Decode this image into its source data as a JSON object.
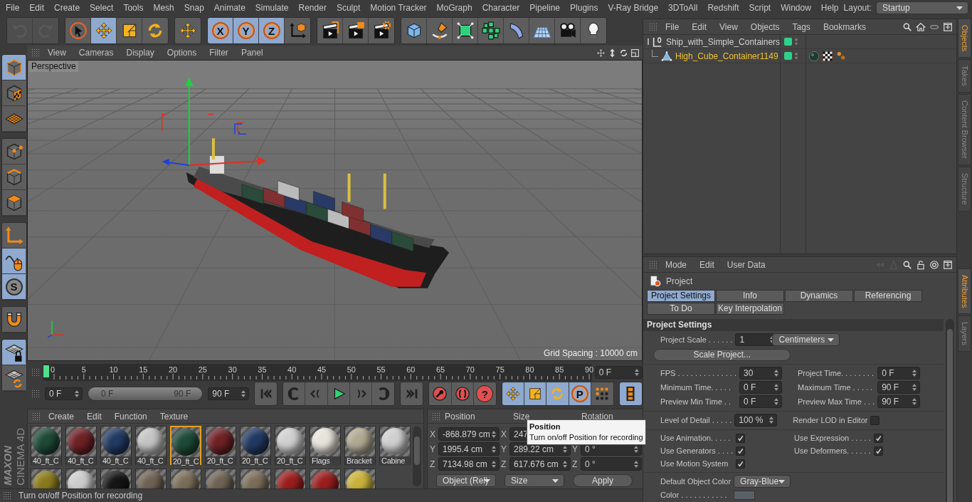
{
  "menu": [
    "File",
    "Edit",
    "Create",
    "Select",
    "Tools",
    "Mesh",
    "Snap",
    "Animate",
    "Simulate",
    "Render",
    "Sculpt",
    "Motion Tracker",
    "MoGraph",
    "Character",
    "Pipeline",
    "Plugins",
    "V-Ray Bridge",
    "3DToAll",
    "Redshift",
    "Script",
    "Window",
    "Help"
  ],
  "layout": {
    "label": "Layout:",
    "value": "Startup"
  },
  "toolbar": [
    {
      "tools": [
        {
          "kind": "undo",
          "active": false,
          "disabled": true
        },
        {
          "kind": "redo",
          "active": false,
          "disabled": true
        }
      ]
    },
    {
      "tools": [
        {
          "kind": "select",
          "active": false,
          "disabled": false
        },
        {
          "kind": "move",
          "active": true,
          "disabled": false
        },
        {
          "kind": "scale",
          "active": false,
          "disabled": false
        },
        {
          "kind": "rotate",
          "active": false,
          "disabled": false
        }
      ]
    },
    {
      "tools": [
        {
          "kind": "move",
          "active": false,
          "disabled": false
        }
      ]
    },
    {
      "tools": [
        {
          "kind": "axis",
          "label": "X",
          "active": true,
          "disabled": false
        },
        {
          "kind": "axis",
          "label": "Y",
          "active": true,
          "disabled": false
        },
        {
          "kind": "axis",
          "label": "Z",
          "active": true,
          "disabled": false
        },
        {
          "kind": "coord",
          "active": false,
          "disabled": false
        }
      ]
    },
    {
      "tools": [
        {
          "kind": "renderview",
          "active": false,
          "disabled": false
        },
        {
          "kind": "render",
          "active": false,
          "disabled": false
        },
        {
          "kind": "rendersettings",
          "active": false,
          "disabled": false
        }
      ]
    },
    {
      "tools": [
        {
          "kind": "cube",
          "active": false,
          "disabled": false
        },
        {
          "kind": "pen",
          "active": false,
          "disabled": false
        },
        {
          "kind": "generator",
          "active": false,
          "disabled": false
        },
        {
          "kind": "cloner",
          "active": false,
          "disabled": false
        },
        {
          "kind": "deformer",
          "active": false,
          "disabled": false
        },
        {
          "kind": "floor",
          "active": false,
          "disabled": false
        },
        {
          "kind": "camera",
          "active": false,
          "disabled": false
        },
        {
          "kind": "light",
          "active": false,
          "disabled": false
        }
      ]
    }
  ],
  "sidetools": [
    {
      "tools": [
        {
          "kind": "model",
          "active": true
        },
        {
          "kind": "texture",
          "active": false
        },
        {
          "kind": "workplane",
          "active": false
        }
      ]
    },
    {
      "tools": [
        {
          "kind": "points",
          "active": false
        },
        {
          "kind": "edges",
          "active": false
        },
        {
          "kind": "polygons",
          "active": false
        }
      ]
    },
    {
      "tools": [
        {
          "kind": "axistool",
          "active": false
        },
        {
          "kind": "tweak",
          "active": true
        },
        {
          "kind": "snap",
          "label": "S",
          "active": true
        }
      ]
    },
    {
      "tools": [
        {
          "kind": "magnet",
          "active": false
        }
      ]
    },
    {
      "tools": [
        {
          "kind": "lockwp",
          "active": true
        },
        {
          "kind": "syncwp",
          "active": false
        }
      ]
    }
  ],
  "logo": {
    "brand": "MAXON",
    "product": "CINEMA 4D"
  },
  "viewport": {
    "menu": [
      "View",
      "Cameras",
      "Display",
      "Options",
      "Filter",
      "Panel"
    ],
    "camera": "Perspective",
    "grid_spacing": "Grid Spacing : 10000 cm"
  },
  "timeline": {
    "ticks": [
      "0",
      "5",
      "10",
      "15",
      "20",
      "25",
      "30",
      "35",
      "40",
      "45",
      "50",
      "55",
      "60",
      "65",
      "70",
      "75",
      "80",
      "85",
      "90"
    ],
    "current_frame": "0 F",
    "start": "0 F",
    "range": {
      "start": "0 F",
      "end": "90 F",
      "level": 1
    },
    "end": "90 F",
    "transport": [
      {
        "tools": [
          {
            "kind": "first",
            "active": false
          }
        ]
      },
      {
        "tools": [
          {
            "kind": "prevkey",
            "active": false
          },
          {
            "kind": "prevframe",
            "active": false
          },
          {
            "kind": "play",
            "active": false
          },
          {
            "kind": "nextframe",
            "active": false
          },
          {
            "kind": "nextkey",
            "active": false
          }
        ]
      },
      {
        "tools": [
          {
            "kind": "last",
            "active": false
          }
        ]
      },
      {
        "tools": [
          {
            "kind": "record",
            "active": false
          },
          {
            "kind": "autokey",
            "active": false
          },
          {
            "kind": "keysel",
            "label": "?",
            "active": false
          }
        ]
      },
      {
        "tools": [
          {
            "kind": "move",
            "active": true
          },
          {
            "kind": "scale",
            "active": true
          },
          {
            "kind": "rotate",
            "active": true
          },
          {
            "kind": "param",
            "label": "P",
            "active": true
          },
          {
            "kind": "dots",
            "active": false
          }
        ]
      },
      {
        "tools": [
          {
            "kind": "film",
            "active": true
          }
        ]
      }
    ]
  },
  "materials": {
    "menu": [
      "Create",
      "Edit",
      "Function",
      "Texture"
    ],
    "items": [
      {
        "name": "40_ft_C",
        "color": "#1f4a38",
        "selected": false
      },
      {
        "name": "40_ft_C",
        "color": "#6e2226",
        "selected": false
      },
      {
        "name": "40_ft_C",
        "color": "#223a63",
        "selected": false
      },
      {
        "name": "40_ft_C",
        "color": "#c4c4c4",
        "selected": false
      },
      {
        "name": "20_ft_C",
        "color": "#1f4a38",
        "selected": true
      },
      {
        "name": "20_ft_C",
        "color": "#6e2226",
        "selected": false
      },
      {
        "name": "20_ft_C",
        "color": "#223a63",
        "selected": false
      },
      {
        "name": "20_ft_C",
        "color": "#d0d0d0",
        "selected": false
      },
      {
        "name": "Flags",
        "color": "#e8e4dc",
        "selected": false
      },
      {
        "name": "Bracket",
        "color": "#b0a892",
        "selected": false
      },
      {
        "name": "Cabine",
        "color": "#cfcfcf",
        "selected": false
      },
      {
        "color": "#8a7a1e",
        "selected": false
      },
      {
        "color": "#cccccc",
        "selected": false
      },
      {
        "color": "#151515",
        "selected": false
      },
      {
        "color": "#6e6254",
        "selected": false
      },
      {
        "color": "#7a6e5a",
        "selected": false
      },
      {
        "color": "#6e6254",
        "selected": false
      },
      {
        "color": "#7a6e5a",
        "selected": false
      },
      {
        "color": "#9a1e1e",
        "selected": false
      },
      {
        "color": "#9a1e1e",
        "selected": false
      },
      {
        "color": "#c9b23a",
        "selected": false
      }
    ]
  },
  "coordinates": {
    "headers": [
      "Position",
      "Size",
      "Rotation"
    ],
    "rows": [
      {
        "axis": "X",
        "position": "-868.879 cm",
        "size_axis": "X",
        "size": "247"
      },
      {
        "axis": "Y",
        "position": "1995.4 cm",
        "size_axis": "Y",
        "size": "289.22 cm",
        "rotation_axis": "Y",
        "rotation": "0 °"
      },
      {
        "axis": "Z",
        "position": "7134.98 cm",
        "size_axis": "Z",
        "size": "617.676 cm",
        "rotation_axis": "Z",
        "rotation": "0 °"
      }
    ],
    "mode": "Object (Rel)",
    "size_mode": "Size",
    "apply": "Apply"
  },
  "tooltip": {
    "title": "Position",
    "text": "Turn on/off Position for recording"
  },
  "status": "Turn on/off Position for recording",
  "objects": {
    "menu": [
      "File",
      "Edit",
      "View",
      "Objects",
      "Tags",
      "Bookmarks"
    ],
    "items": [
      {
        "name": "Ship_with_Simple_Containers",
        "kind": "null",
        "selected": false,
        "enabled": true
      },
      {
        "name": "High_Cube_Container1149",
        "kind": "polygon",
        "selected": true,
        "enabled": true,
        "tags": [
          {
            "kind": "material"
          },
          {
            "kind": "texture"
          },
          {
            "kind": "points"
          }
        ]
      }
    ]
  },
  "attributes": {
    "menu": [
      "Mode",
      "Edit",
      "User Data"
    ],
    "title": "Project",
    "tabs": [
      {
        "label": "Project Settings",
        "selected": true
      },
      {
        "label": "Info",
        "selected": false
      },
      {
        "label": "Dynamics",
        "selected": false
      },
      {
        "label": "Referencing",
        "selected": false
      },
      {
        "label": "To Do",
        "selected": false
      },
      {
        "label": "Key Interpolation",
        "selected": false
      }
    ],
    "section": "Project Settings",
    "scale": {
      "label": "Project Scale . . . . . .",
      "value": "1",
      "unit": "Centimeters",
      "button": "Scale Project..."
    },
    "time_rows": [
      {
        "label": "FPS . . . . . . . . . . . . . .",
        "value": "30",
        "label2": "Project Time. . . . . . . .",
        "value2": "0 F"
      },
      {
        "label": "Minimum Time. . . . .",
        "value": "0 F",
        "label2": "Maximum Time . . . . .",
        "value2": "90 F"
      },
      {
        "label": "Preview Min Time . .",
        "value": "0 F",
        "label2": "Preview Max Time . . .",
        "value2": "90 F"
      }
    ],
    "lod": {
      "label": "Level of Detail . . . . .",
      "value": "100 %",
      "render_label": "Render LOD in Editor",
      "render_checked": false
    },
    "checks": [
      {
        "label": "Use Animation. . . . .",
        "checked": true
      },
      {
        "label": "Use Expression . . . . .",
        "checked": true
      },
      {
        "label": "Use Generators . . . .",
        "checked": true
      },
      {
        "label": "Use Deformers. . . . . .",
        "checked": true
      },
      {
        "label": "Use Motion System",
        "checked": true
      }
    ],
    "object_color": {
      "label": "Default Object Color",
      "value": "Gray-Blue",
      "color_label": "Color . . . . . . . . . . ."
    }
  },
  "dock_tabs": [
    {
      "label": "Objects",
      "selected": true
    },
    {
      "label": "Takes",
      "selected": false
    },
    {
      "label": "Content Browser",
      "selected": false
    },
    {
      "label": "Structure",
      "selected": false
    }
  ],
  "attr_dock_tabs": [
    {
      "label": "Attributes",
      "selected": true
    },
    {
      "label": "Layers",
      "selected": false
    }
  ]
}
